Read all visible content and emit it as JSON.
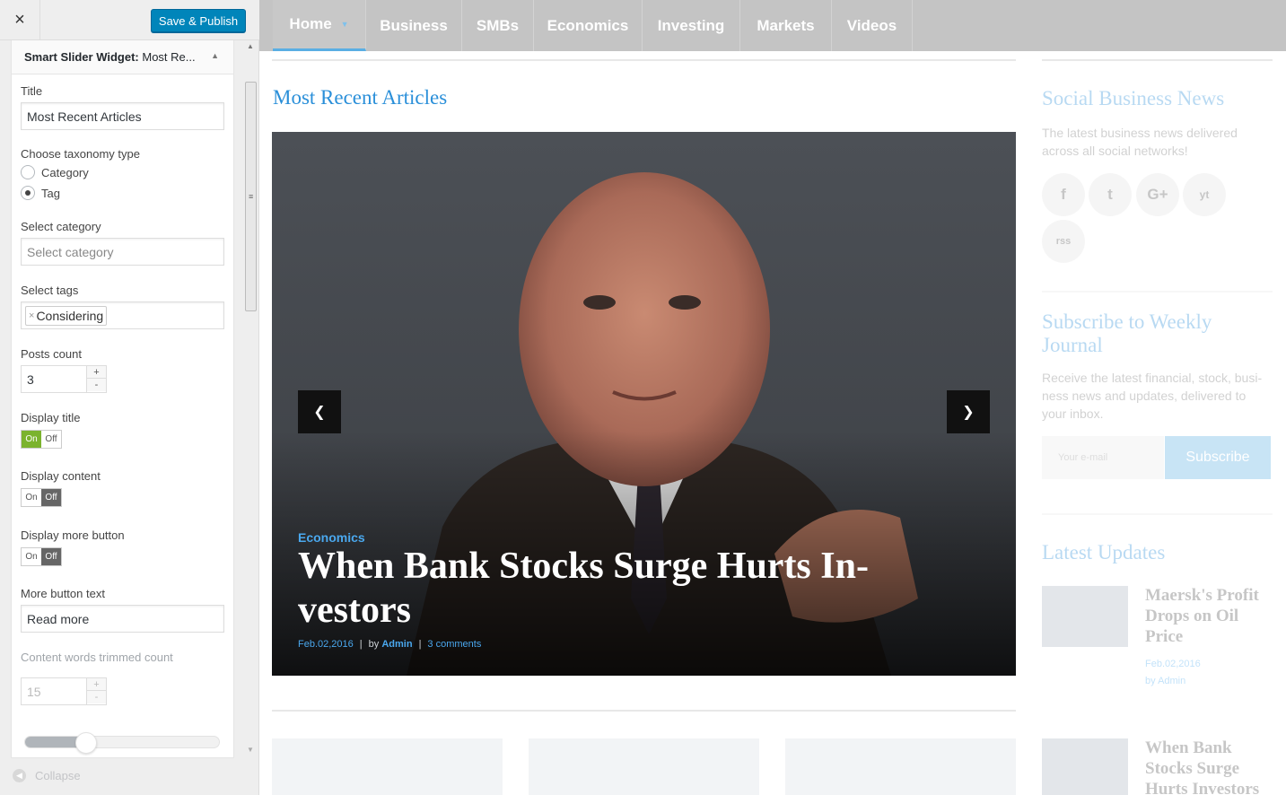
{
  "customizer": {
    "close_icon": "×",
    "save_label": "Save & Publish",
    "widget_title_prefix": "Smart Slider Widget:",
    "widget_title_suffix": "Most Re...",
    "fields": {
      "title_label": "Title",
      "title_value": "Most Recent Articles",
      "taxonomy_label": "Choose taxonomy type",
      "taxonomy_options": [
        "Category",
        "Tag"
      ],
      "taxonomy_selected": "Tag",
      "category_label": "Select category",
      "category_placeholder": "Select category",
      "tags_label": "Select tags",
      "tags_selected": [
        "Considering"
      ],
      "posts_count_label": "Posts count",
      "posts_count_value": "3",
      "display_title_label": "Display title",
      "display_title_state": "on",
      "display_content_label": "Display content",
      "display_content_state": "off",
      "display_more_label": "Display more button",
      "display_more_state": "off",
      "toggle_on": "On",
      "toggle_off": "Off",
      "more_text_label": "More button text",
      "more_text_value": "Read more",
      "trim_label": "Content words trimmed count",
      "trim_value": "15",
      "range_fraction": 0.25
    },
    "collapse_label": "Collapse"
  },
  "nav": {
    "items": [
      "Home",
      "Business",
      "SMBs",
      "Economics",
      "Investing",
      "Markets",
      "Videos"
    ],
    "active": "Home"
  },
  "main": {
    "heading": "Most Recent Articles",
    "slide": {
      "category": "Economics",
      "title": "When Bank Stocks Surge Hurts In-vestors",
      "date": "Feb.02,2016",
      "by": "by",
      "author": "Admin",
      "comments": "3 comments"
    }
  },
  "sidebar": {
    "social_heading": "Social Business News",
    "social_text": "The latest business news delivered across all social networks!",
    "social_icons": [
      "f",
      "t",
      "G+",
      "yt",
      "rss"
    ],
    "subscribe_heading": "Subscribe to Weekly Journal",
    "subscribe_text": "Receive the latest financial, stock, busi-ness news and updates, delivered to your inbox.",
    "email_placeholder": "Your e-mail",
    "subscribe_label": "Subscribe",
    "updates_heading": "Latest Updates",
    "updates": [
      {
        "title": "Maersk's Profit Drops on Oil Price",
        "date": "Feb.02,2016",
        "author": "by Admin"
      },
      {
        "title": "When Bank Stocks Surge Hurts Investors",
        "date": "",
        "author": ""
      }
    ]
  },
  "colors": {
    "accent": "#2a8fd9",
    "wp_button": "#0085ba",
    "nav_bg": "#c4c4c4",
    "toggle_on": "#7bb32e"
  }
}
